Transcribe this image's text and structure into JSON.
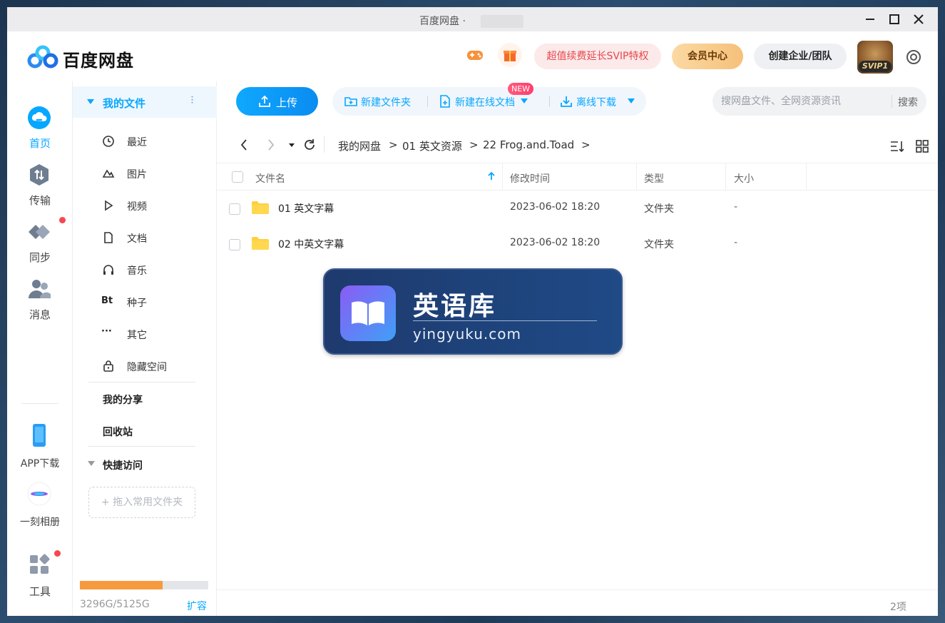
{
  "window": {
    "title": "百度网盘 ·"
  },
  "header": {
    "logo_text": "百度网盘",
    "svip_promo": "超值续费延长SVIP特权",
    "vip_center": "会员中心",
    "create_team": "创建企业/团队",
    "avatar_badge": "SVIP1"
  },
  "rail": {
    "items": [
      {
        "label": "首页",
        "icon": "cloud-icon"
      },
      {
        "label": "传输",
        "icon": "transfer-icon"
      },
      {
        "label": "同步",
        "icon": "sync-icon"
      },
      {
        "label": "消息",
        "icon": "message-icon"
      }
    ],
    "app_download": "APP下载",
    "yike": "一刻相册",
    "tools": "工具"
  },
  "sidebar": {
    "my_files": "我的文件",
    "items": [
      {
        "label": "最近",
        "icon": "clock-icon"
      },
      {
        "label": "图片",
        "icon": "image-icon"
      },
      {
        "label": "视频",
        "icon": "play-icon"
      },
      {
        "label": "文档",
        "icon": "document-icon"
      },
      {
        "label": "音乐",
        "icon": "headphones-icon"
      },
      {
        "label": "种子",
        "icon": "bt-icon",
        "glyph": "Bt"
      },
      {
        "label": "其它",
        "icon": "more-icon",
        "glyph": "···"
      },
      {
        "label": "隐藏空间",
        "icon": "lock-icon"
      }
    ],
    "my_share": "我的分享",
    "recycle": "回收站",
    "quick_access": "快捷访问",
    "drop_hint": "+ 拖入常用文件夹",
    "quota_text": "3296G/5125G",
    "quota_used_fraction": 0.643,
    "expand": "扩容"
  },
  "toolbar": {
    "upload": "上传",
    "new_folder": "新建文件夹",
    "new_online_doc": "新建在线文档",
    "new_badge": "NEW",
    "offline_download": "离线下载",
    "search_placeholder": "搜网盘文件、全网资源资讯",
    "search_button": "搜索"
  },
  "breadcrumb": {
    "items": [
      "我的网盘",
      "01 英文资源",
      "22 Frog.and.Toad"
    ],
    "separator": ">"
  },
  "table": {
    "headers": {
      "name": "文件名",
      "modified": "修改时间",
      "type": "类型",
      "size": "大小"
    },
    "rows": [
      {
        "name": "01 英文字幕",
        "modified": "2023-06-02 18:20",
        "type": "文件夹",
        "size": "-"
      },
      {
        "name": "02 中英文字幕",
        "modified": "2023-06-02 18:20",
        "type": "文件夹",
        "size": "-"
      }
    ]
  },
  "footer": {
    "count": "2项"
  },
  "watermark": {
    "title": "英语库",
    "url": "yingyuku.com"
  },
  "colors": {
    "accent": "#06a7ff",
    "badge_red": "#f5474e",
    "quota": "#f79a3e"
  }
}
